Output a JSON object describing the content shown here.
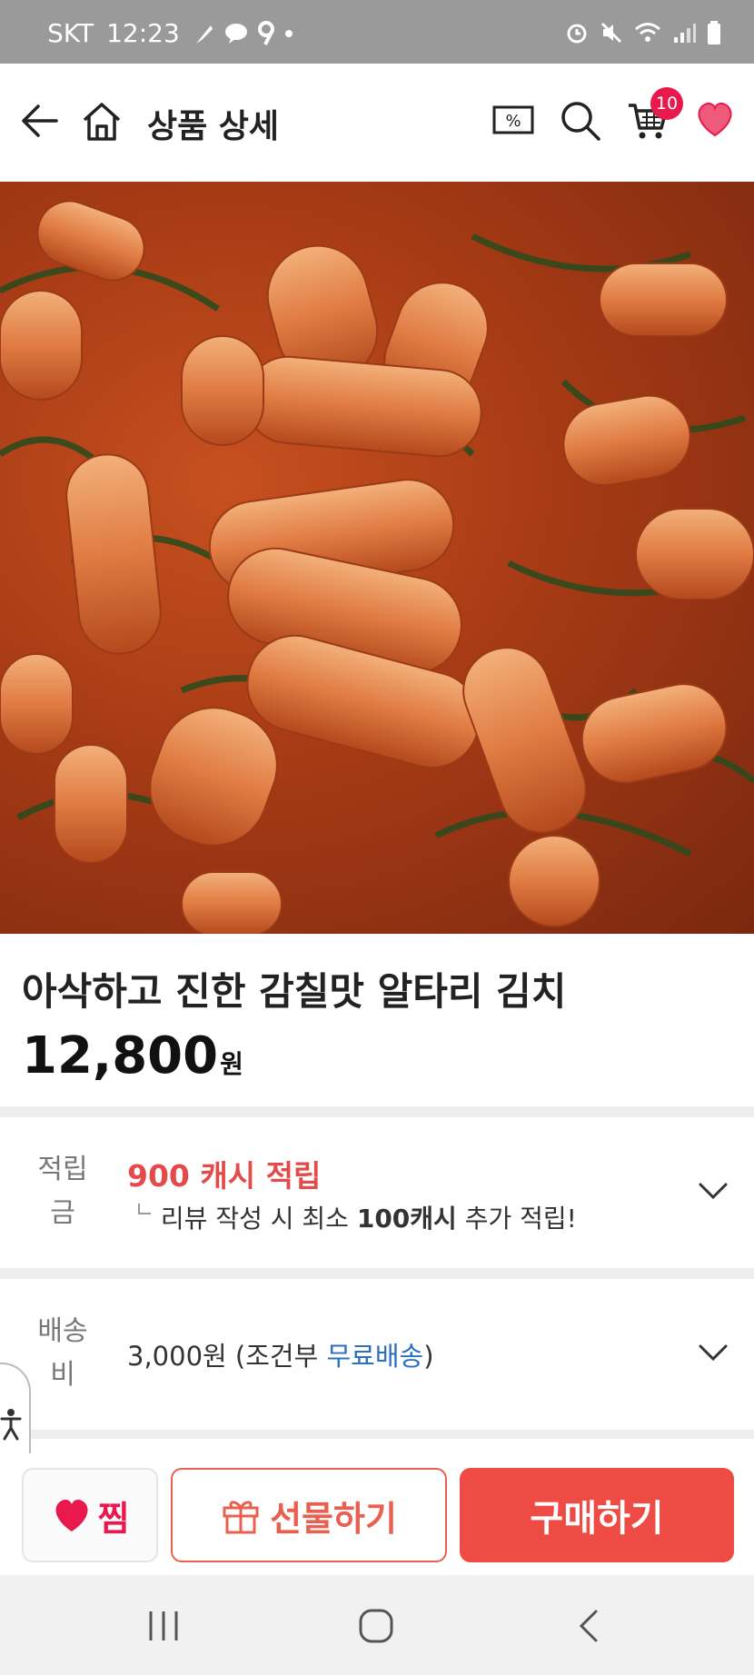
{
  "status_bar": {
    "carrier": "SKT",
    "time": "12:23"
  },
  "header": {
    "title": "상품 상세",
    "cart_count": "10",
    "icons": [
      "back-arrow-icon",
      "home-icon",
      "coupon-icon",
      "search-icon",
      "cart-icon",
      "heart-icon"
    ],
    "coupon_symbol": "%"
  },
  "product": {
    "image_alt": "알타리 김치 상품 이미지",
    "title": "아삭하고 진한 감칠맛 알타리 김치",
    "price": "12,800",
    "price_unit": "원"
  },
  "points": {
    "label_line1": "적립",
    "label_line2": "금",
    "main": "900 캐시 적립",
    "sub_prefix": "리뷰 작성 시 최소 ",
    "sub_bold": "100캐시",
    "sub_suffix": " 추가 적립!"
  },
  "shipping": {
    "label_line1": "배송",
    "label_line2": "비",
    "fee": "3,000원 (조건부 ",
    "free": "무료배송",
    "close_paren": ")"
  },
  "actions": {
    "zzim": "찜",
    "gift": "선물하기",
    "buy": "구매하기"
  },
  "colors": {
    "accent_pink": "#e8194d",
    "points_red": "#e34a4a",
    "buy_red": "#ee4b45",
    "free_blue": "#2b6fbf"
  }
}
